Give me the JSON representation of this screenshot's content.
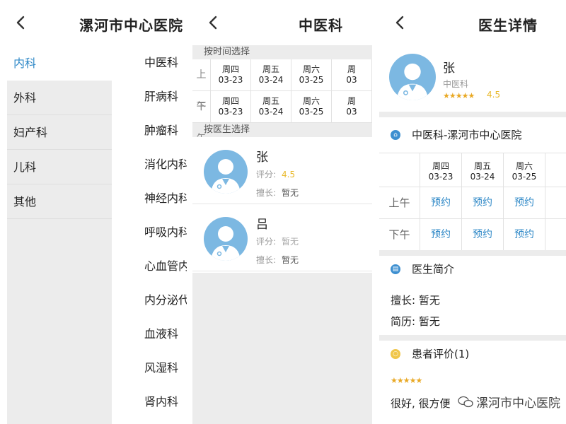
{
  "panel1": {
    "title": "漯河市中心医院",
    "categories": [
      "内科",
      "外科",
      "妇产科",
      "儿科",
      "其他"
    ],
    "subdepartments": [
      "中医科",
      "肝病科",
      "肿瘤科",
      "消化内科",
      "神经内科",
      "呼吸内科",
      "心血管内",
      "内分泌代",
      "血液科",
      "风湿科",
      "肾内科"
    ]
  },
  "panel2": {
    "title": "中医科",
    "by_time_label": "按时间选择",
    "by_doctor_label": "按医生选择",
    "morning": "上午",
    "afternoon": "下午",
    "days": [
      {
        "weekday": "周四",
        "date": "03-23"
      },
      {
        "weekday": "周五",
        "date": "03-24"
      },
      {
        "weekday": "周六",
        "date": "03-25"
      },
      {
        "weekday": "周",
        "date": "03"
      }
    ],
    "doctors": [
      {
        "name": "张",
        "rating_label": "评分:",
        "rating": "4.5",
        "specialty_label": "擅长:",
        "specialty": "暂无"
      },
      {
        "name": "吕",
        "rating_label": "评分:",
        "rating": "暂无",
        "specialty_label": "擅长:",
        "specialty": "暂无"
      }
    ]
  },
  "panel3": {
    "title": "医生详情",
    "doctor_name": "张",
    "department": "中医科",
    "stars": "★★★★★",
    "score": "4.5",
    "hospital_section": "中医科-漯河市中心医院",
    "morning": "上午",
    "afternoon": "下午",
    "days": [
      {
        "weekday": "周四",
        "date": "03-23"
      },
      {
        "weekday": "周五",
        "date": "03-24"
      },
      {
        "weekday": "周六",
        "date": "03-25"
      },
      {
        "weekday": "",
        "date": ""
      }
    ],
    "book_label": "预约",
    "intro_section": "医生简介",
    "specialty_line": "擅长: 暂无",
    "resume_line": "简历: 暂无",
    "reviews_section": "患者评价(1)",
    "review_stars": "★★★★★",
    "review_text": "很好, 很方便"
  },
  "watermark": "漯河市中心医院",
  "colors": {
    "accent": "#2e88c7",
    "star": "#e9a925",
    "avatar": "#7cb8e2",
    "grey_bg": "#ececec"
  }
}
